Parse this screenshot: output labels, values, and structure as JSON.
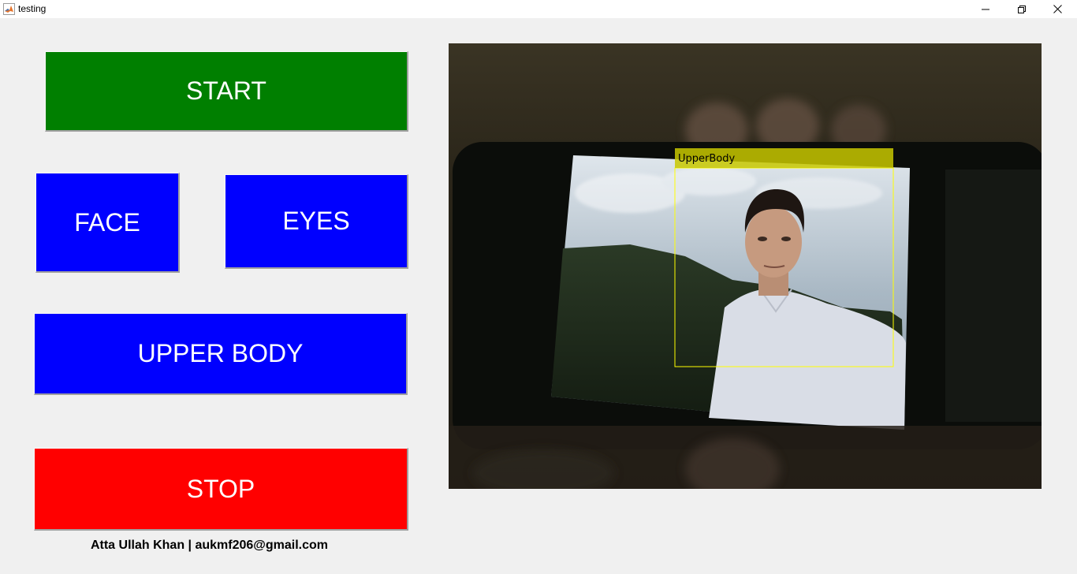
{
  "window": {
    "title": "testing",
    "controls": [
      "minimize",
      "restore",
      "close"
    ]
  },
  "buttons": {
    "start": "START",
    "face": "FACE",
    "eyes": "EYES",
    "upper_body": "UPPER BODY",
    "stop": "STOP"
  },
  "video": {
    "detection_label": "UpperBody",
    "box_color": "#ffff00"
  },
  "footer": {
    "credit": "Atta Ullah Khan | aukmf206@gmail.com"
  },
  "colors": {
    "start": "#007f00",
    "detect": "#0000ff",
    "stop": "#ff0000",
    "background": "#f0f0f0"
  }
}
